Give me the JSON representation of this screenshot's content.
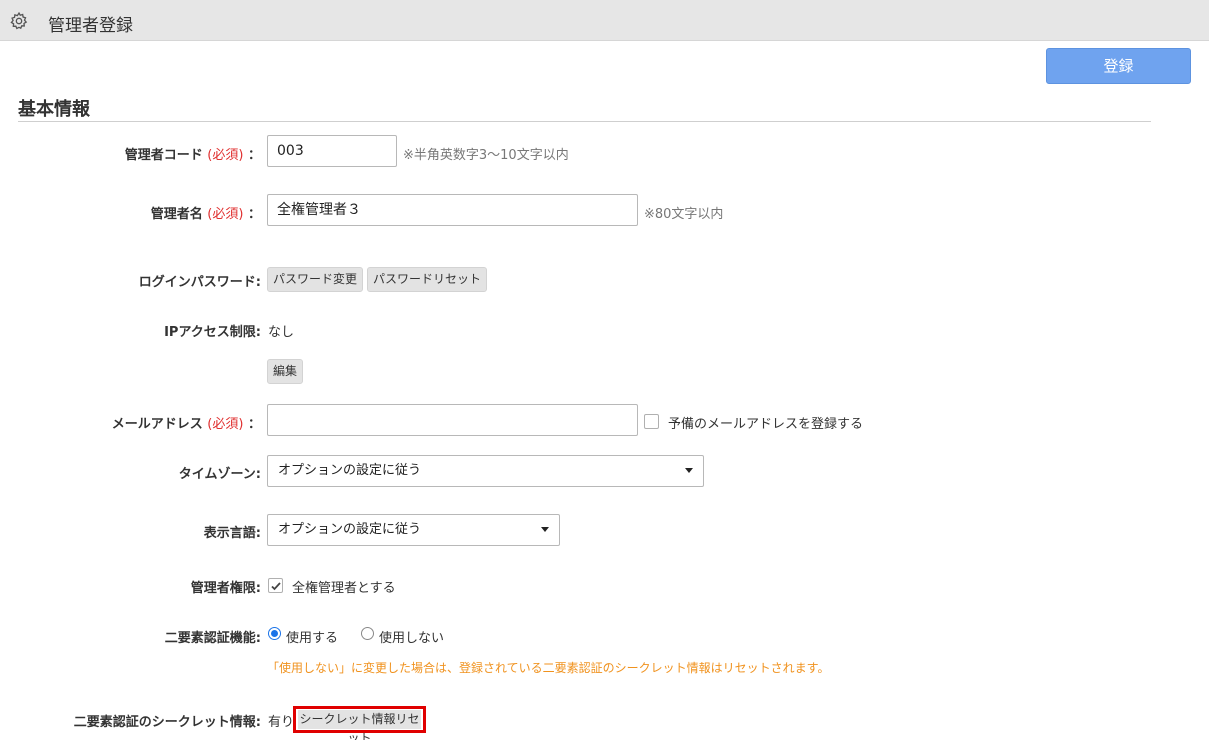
{
  "header": {
    "title": "管理者登録",
    "icon": "gear-icon"
  },
  "toolbar": {
    "register_label": "登録"
  },
  "section": {
    "title": "基本情報"
  },
  "required_mark": "(必須)",
  "form": {
    "admin_code": {
      "label": "管理者コード",
      "colon": "：",
      "value": "003",
      "hint": "※半角英数字3〜10文字以内"
    },
    "admin_name": {
      "label": "管理者名",
      "colon": "：",
      "value": "全権管理者３",
      "hint": "※80文字以内"
    },
    "login_password": {
      "label": "ログインパスワード:",
      "change_label": "パスワード変更",
      "reset_label": "パスワードリセット"
    },
    "ip_restriction": {
      "label": "IPアクセス制限:",
      "value": "なし",
      "edit_label": "編集"
    },
    "email": {
      "label": "メールアドレス",
      "colon": "：",
      "value": "",
      "backup_label": "予備のメールアドレスを登録する",
      "backup_checked": false
    },
    "timezone": {
      "label": "タイムゾーン:",
      "selected": "オプションの設定に従う"
    },
    "language": {
      "label": "表示言語:",
      "selected": "オプションの設定に従う"
    },
    "admin_authority": {
      "label": "管理者権限:",
      "checkbox_label": "全権管理者とする",
      "checked": true
    },
    "two_factor": {
      "label": "二要素認証機能:",
      "options": [
        "使用する",
        "使用しない"
      ],
      "selected": "使用する",
      "warning": "「使用しない」に変更した場合は、登録されている二要素認証のシークレット情報はリセットされます。"
    },
    "two_factor_secret": {
      "label": "二要素認証のシークレット情報:",
      "value": "有り",
      "reset_label": "シークレット情報リセット"
    }
  },
  "colors": {
    "primary_button": "#6fa3ef",
    "required": "#e03030",
    "warning": "#f0921e",
    "radio": "#1a73e8",
    "highlight_border": "#e00000"
  }
}
